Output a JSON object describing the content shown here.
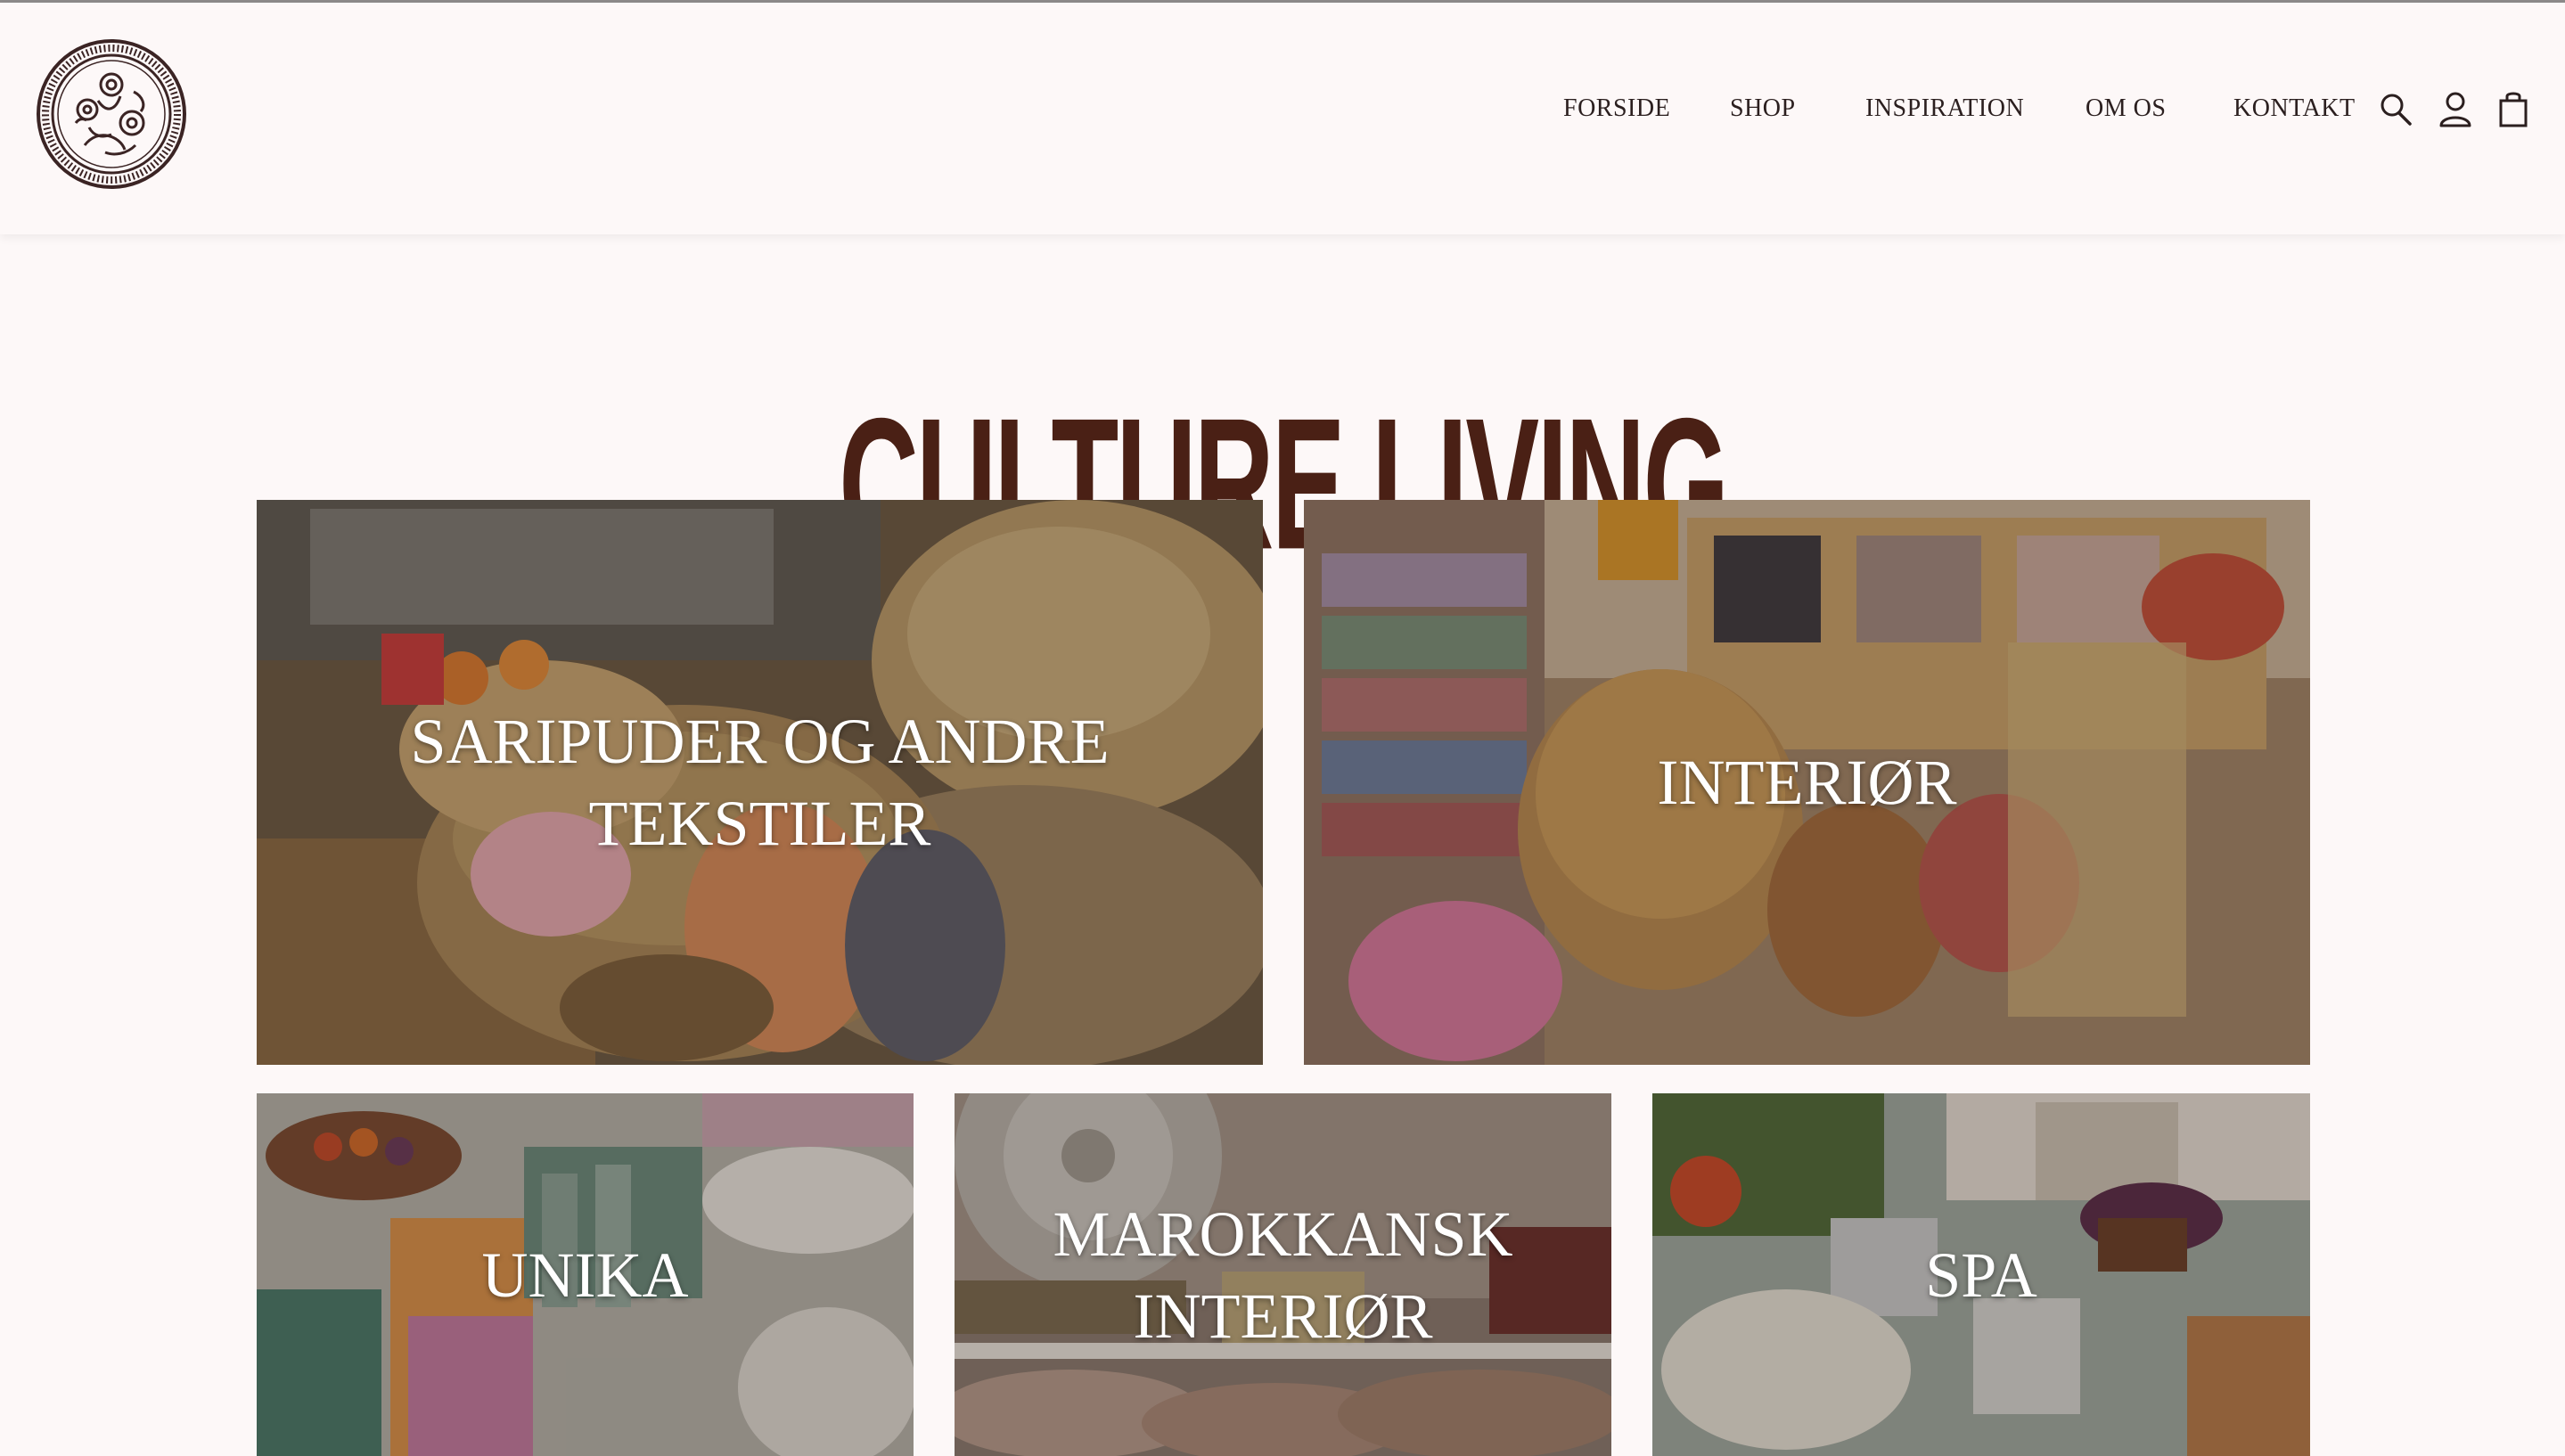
{
  "header": {
    "logo_name": "floral-medallion-logo",
    "nav": [
      {
        "label": "FORSIDE"
      },
      {
        "label": "SHOP"
      },
      {
        "label": "INSPIRATION"
      },
      {
        "label": "OM OS"
      },
      {
        "label": "KONTAKT"
      }
    ],
    "icons": [
      "search-icon",
      "user-icon",
      "cart-icon"
    ]
  },
  "main": {
    "title": "CULTURE LIVING",
    "categories": [
      {
        "label": "SARIPUDER OG ANDRE TEKSTILER"
      },
      {
        "label": "INTERIØR"
      },
      {
        "label": "UNIKA"
      },
      {
        "label": "MAROKKANSK INTERIØR"
      },
      {
        "label": "SPA"
      }
    ]
  },
  "colors": {
    "background": "#fdf8f8",
    "title": "#4a2015",
    "nav_text": "#2b1f1f",
    "caption": "#ffffff"
  }
}
